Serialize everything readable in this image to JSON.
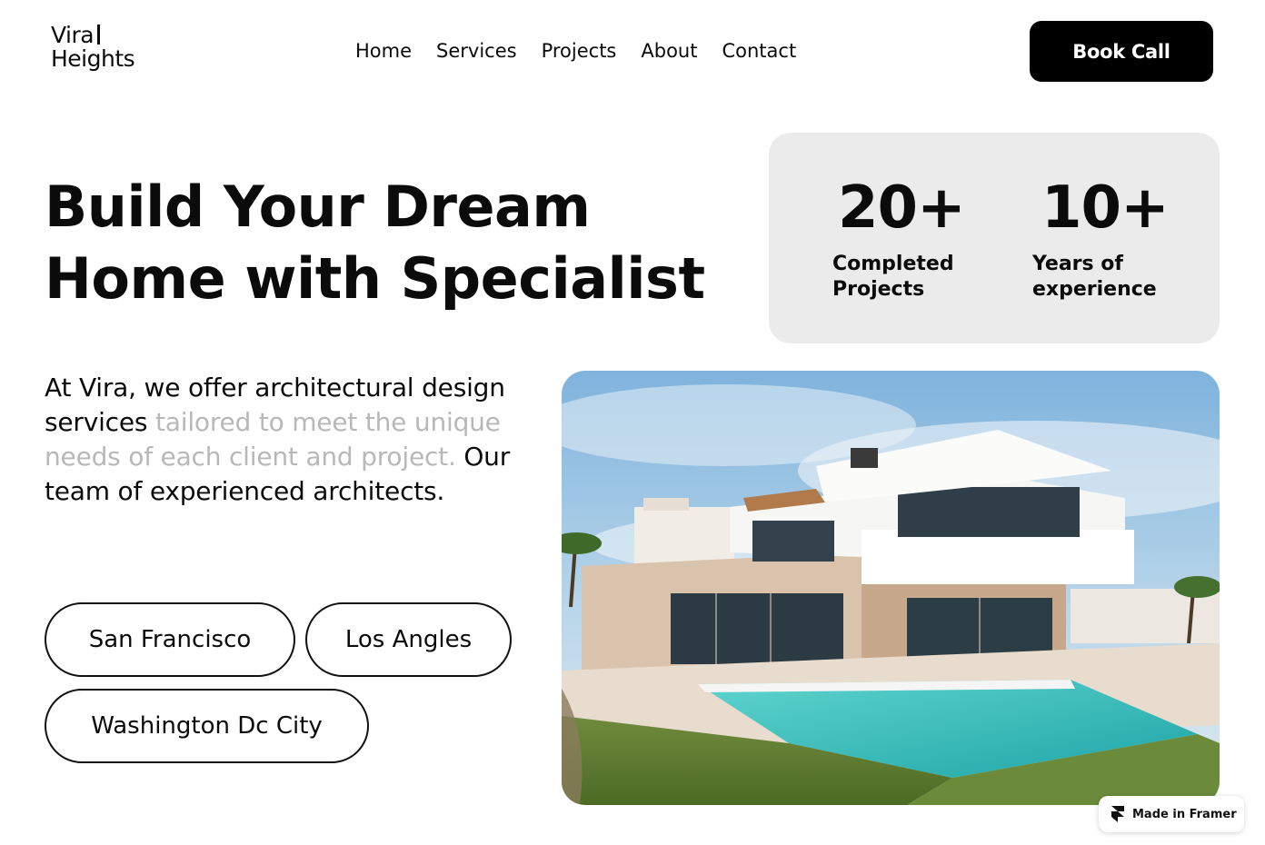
{
  "brand": {
    "logo_line1": "Vira",
    "logo_line2": "Heights"
  },
  "nav": {
    "items": [
      {
        "label": "Home"
      },
      {
        "label": "Services"
      },
      {
        "label": "Projects"
      },
      {
        "label": "About"
      },
      {
        "label": "Contact"
      }
    ]
  },
  "header": {
    "cta_label": "Book Call"
  },
  "hero": {
    "title_line1": "Build Your Dream",
    "title_line2": "Home with Specialist"
  },
  "stats": [
    {
      "value": "20+",
      "label_line1": "Completed",
      "label_line2": "Projects"
    },
    {
      "value": "10+",
      "label_line1": "Years of",
      "label_line2": "experience"
    }
  ],
  "description": {
    "part1": "At Vira, we offer architectural design services ",
    "part2_muted": "tailored to meet the unique needs of each client and project.",
    "part3": " Our team of experienced architects."
  },
  "locations": [
    {
      "label": "San Francisco"
    },
    {
      "label": "Los Angles"
    },
    {
      "label": "Washington Dc City"
    }
  ],
  "badge": {
    "label": "Made in Framer",
    "icon": "framer-icon"
  },
  "colors": {
    "accent": "#000000",
    "stats_bg": "#ebebeb",
    "muted_text": "#b8b8b8"
  }
}
